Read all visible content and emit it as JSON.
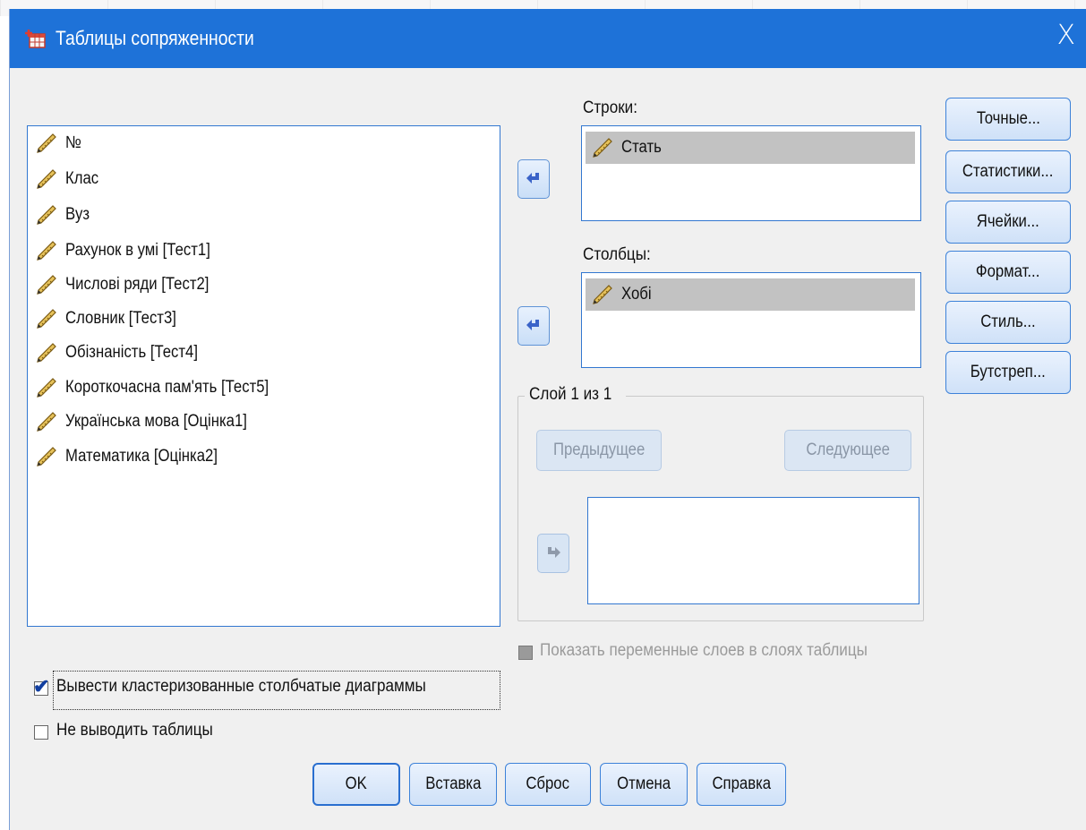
{
  "window": {
    "title": "Таблицы сопряженности",
    "close_label": "X"
  },
  "variables": [
    "№",
    "Клас",
    "Вуз",
    "Рахунок в умі [Тест1]",
    "Числові ряди [Тест2]",
    "Словник [Тест3]",
    "Обізнаність [Тест4]",
    "Короткочасна пам'ять [Тест5]",
    "Українська мова [Оцінка1]",
    "Математика [Оцінка2]"
  ],
  "rows_section": {
    "label": "Строки:",
    "items": [
      "Стать"
    ]
  },
  "columns_section": {
    "label": "Столбцы:",
    "items": [
      "Хобі"
    ]
  },
  "layer": {
    "legend": "Слой 1 из 1",
    "prev_label": "Предыдущее",
    "next_label": "Следующее"
  },
  "side_buttons": {
    "exact": "Точные...",
    "statistics": "Статистики...",
    "cells": "Ячейки...",
    "format": "Формат...",
    "style": "Стиль...",
    "bootstrap": "Бутстреп..."
  },
  "options": {
    "show_layer_vars": {
      "label": "Показать переменные слоев в слоях таблицы",
      "checked": false,
      "enabled": false
    },
    "clustered_bar": {
      "label": "Вывести кластеризованные столбчатые диаграммы",
      "checked": true
    },
    "suppress_tables": {
      "label": "Не выводить таблицы",
      "checked": false
    }
  },
  "bottom_buttons": {
    "ok": "OK",
    "paste": "Вставка",
    "reset": "Сброс",
    "cancel": "Отмена",
    "help": "Справка"
  },
  "colors": {
    "titlebar": "#1e72d8",
    "dialog_bg": "#f0f0f0",
    "selection": "#c2c2c2",
    "accent_border": "#3277d0"
  },
  "icons": {
    "variable": "ruler-pencil-icon",
    "app": "crosstabs-table-icon",
    "move": "arrow-icon"
  }
}
